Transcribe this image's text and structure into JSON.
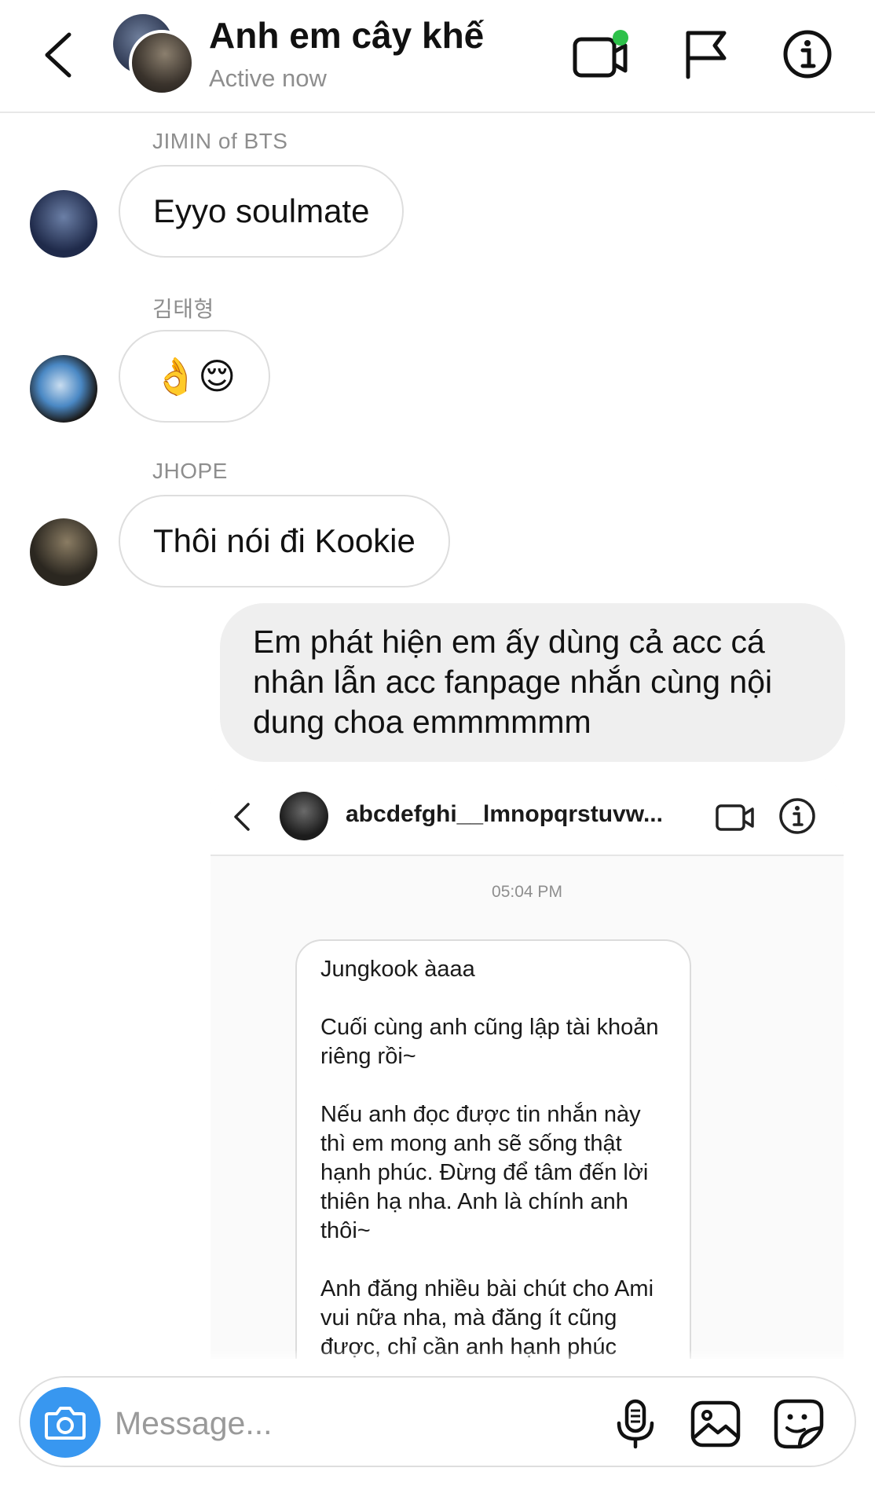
{
  "header": {
    "title": "Anh em cây khế",
    "status": "Active now",
    "icons": [
      "back-icon",
      "video-call-icon",
      "flag-icon",
      "info-icon"
    ],
    "accent_active": "#2ec14a"
  },
  "messages": [
    {
      "sender": "JIMIN of BTS",
      "text": "Eyyo soulmate"
    },
    {
      "sender": "김태형",
      "text": "👌😌"
    },
    {
      "sender": "JHOPE",
      "text": "Thôi nói đi Kookie"
    }
  ],
  "outgoing": {
    "text": "Em phát hiện em ấy dùng cả acc cá nhân lẫn acc fanpage nhắn cùng nội dung choa emmmmmm"
  },
  "shared_screenshot": {
    "username": "abcdefghi__lmnopqrstuvw...",
    "time": "05:04 PM",
    "paragraphs": [
      "Jungkook àaaa",
      "Cuối cùng anh cũng lập tài khoản riêng rồi~",
      "Nếu anh đọc được tin nhắn này thì em mong anh sẽ sống thật hạnh phúc. Đừng để tâm đến lời thiên hạ nha. Anh là chính anh thôi~",
      "Anh đăng nhiều bài chút cho Ami vui nữa nha, mà đăng ít cũng được, chỉ cần anh hạnh phúc"
    ]
  },
  "composer": {
    "placeholder": "Message...",
    "accent": "#3897f0"
  }
}
